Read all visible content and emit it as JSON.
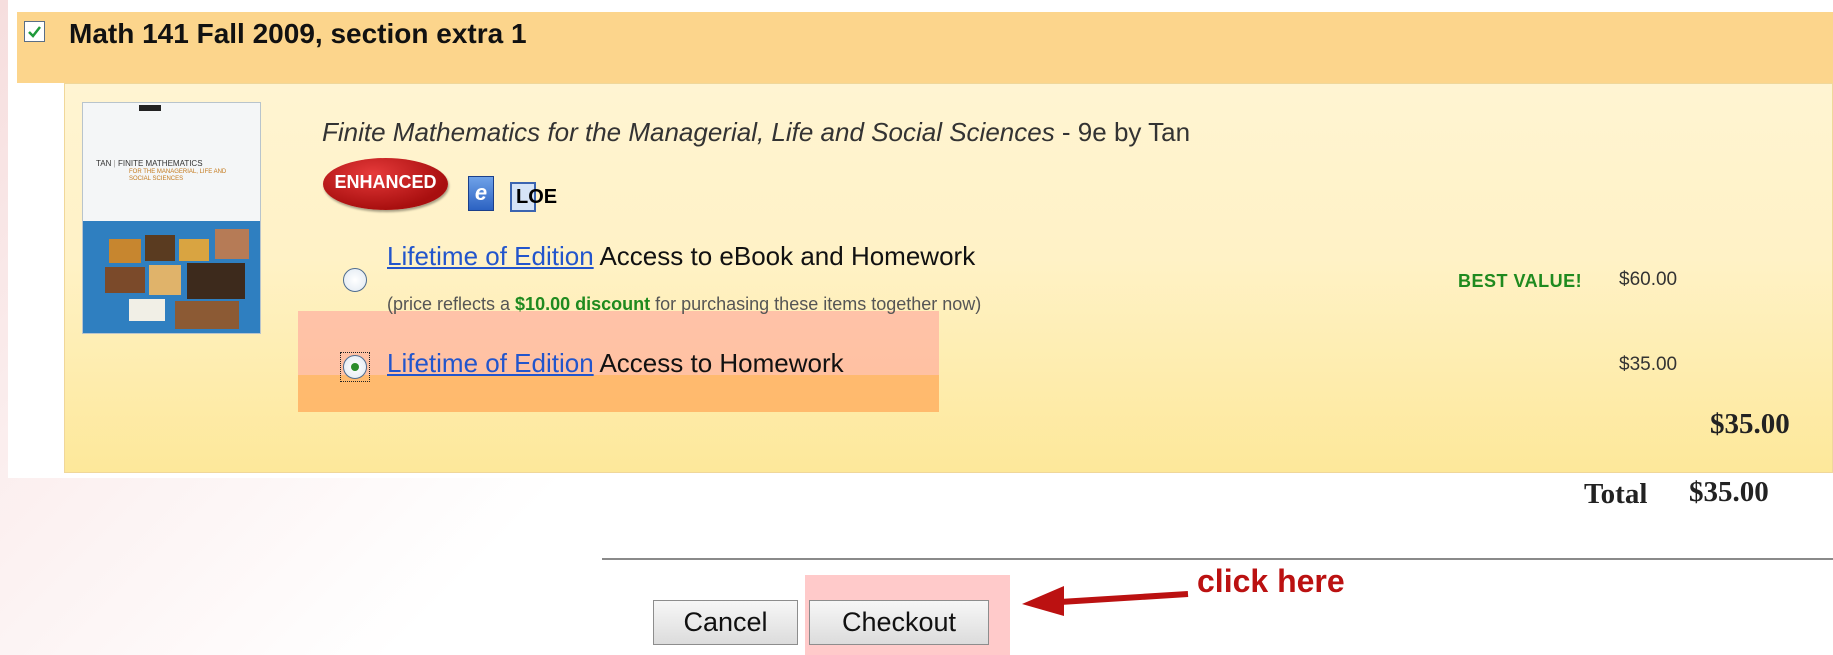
{
  "course": {
    "checked": true,
    "title": "Math 141 Fall 2009, section extra 1"
  },
  "book": {
    "title_italic": "Finite Mathematics for the Managerial, Life and Social Sciences",
    "title_suffix": " - 9e by Tan",
    "cover_author": "TAN",
    "cover_title": "FINITE MATHEMATICS",
    "cover_subtitle": "FOR THE MANAGERIAL, LIFE AND SOCIAL SCIENCES",
    "badge_label": "ENHANCED",
    "ebook_icon_label": "e",
    "loe_icon_label": "LOE"
  },
  "options": [
    {
      "link": "Lifetime of Edition",
      "label": " Access to eBook and Homework",
      "note_prefix": "(price reflects a ",
      "note_discount": "$10.00 discount",
      "note_suffix": " for purchasing these items together now)",
      "badge": "BEST VALUE!",
      "price": "$60.00",
      "selected": false
    },
    {
      "link": "Lifetime of Edition",
      "label": " Access to Homework",
      "price": "$35.00",
      "selected": true
    }
  ],
  "subtotal": "$35.00",
  "total": {
    "label": "Total",
    "value": "$35.00"
  },
  "buttons": {
    "cancel": "Cancel",
    "checkout": "Checkout"
  },
  "annotation": {
    "text": "click here"
  },
  "colors": {
    "header_bg": "#fcd58c",
    "link": "#2255cc",
    "green": "#1f8a1f",
    "annotation_red": "#bb1111",
    "highlight_pink": "#ffb4b4",
    "highlight_orange": "#ffbb80"
  }
}
